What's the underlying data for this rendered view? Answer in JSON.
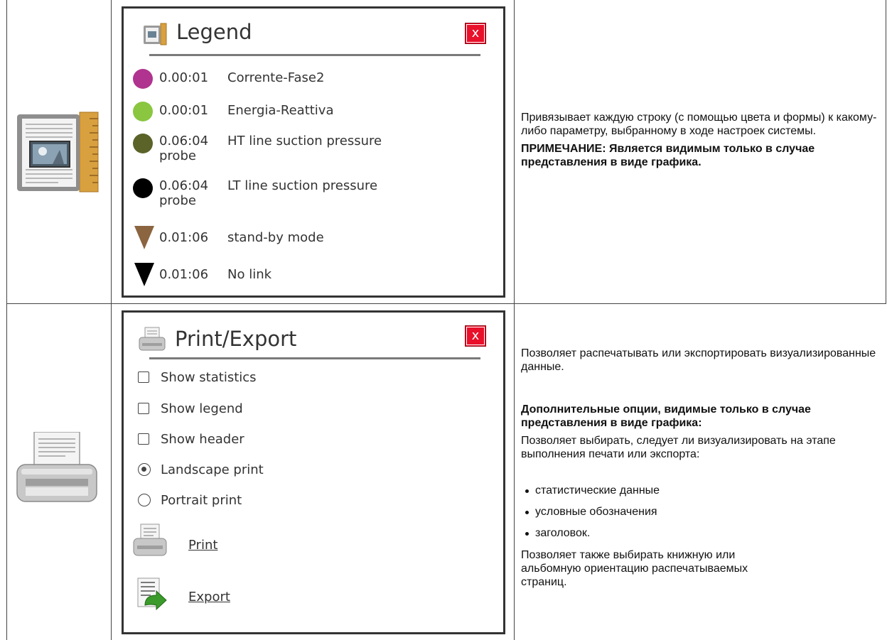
{
  "legend_panel": {
    "title": "Legend",
    "close_label": "x",
    "items": [
      {
        "time": "0.00:01",
        "name": "Corrente-Fase2",
        "marker": "circle",
        "color": "#b0338f"
      },
      {
        "time": "0.00:01",
        "name": "Energia-Reattiva",
        "marker": "circle",
        "color": "#8ac640"
      },
      {
        "time": "0.06:04",
        "name": "HT line suction pressure",
        "name_cont": "probe",
        "marker": "circle",
        "color": "#5b6329"
      },
      {
        "time": "0.06:04",
        "name": "LT line suction pressure",
        "name_cont": "probe",
        "marker": "circle",
        "color": "#000000"
      },
      {
        "time": "0.01:06",
        "name": "stand-by mode",
        "marker": "triangle-down",
        "color": "#8b6540"
      },
      {
        "time": "0.01:06",
        "name": "No link",
        "marker": "triangle-down",
        "color": "#000000"
      }
    ],
    "description": "Привязывает каждую строку (с помощью цвета и формы) к какому-либо параметру, выбранному в ходе настроек системы.",
    "note": "ПРИМЕЧАНИЕ: Является видимым только в случае представления в виде графика."
  },
  "print_panel": {
    "title": "Print/Export",
    "close_label": "x",
    "options": [
      {
        "label": "Show statistics",
        "type": "checkbox",
        "checked": false
      },
      {
        "label": "Show legend",
        "type": "checkbox",
        "checked": false
      },
      {
        "label": "Show header",
        "type": "checkbox",
        "checked": false
      },
      {
        "label": "Landscape print",
        "type": "radio",
        "checked": true
      },
      {
        "label": "Portrait print",
        "type": "radio",
        "checked": false
      }
    ],
    "actions": {
      "print": "Print",
      "export": "Export"
    },
    "description": "Позволяет распечатывать или экспортировать визуализированные данные.",
    "extra_heading": "Дополнительные опции, видимые только в случае представления в виде графика:",
    "extra_text": "Позволяет выбирать, следует ли визуализировать на этапе выполнения печати или экспорта:",
    "bullets": [
      "статистические данные",
      "условные обозначения",
      "заголовок."
    ],
    "orientation_text": "Позволяет также выбирать книжную или альбомную ориентацию распечатываемых страниц."
  }
}
